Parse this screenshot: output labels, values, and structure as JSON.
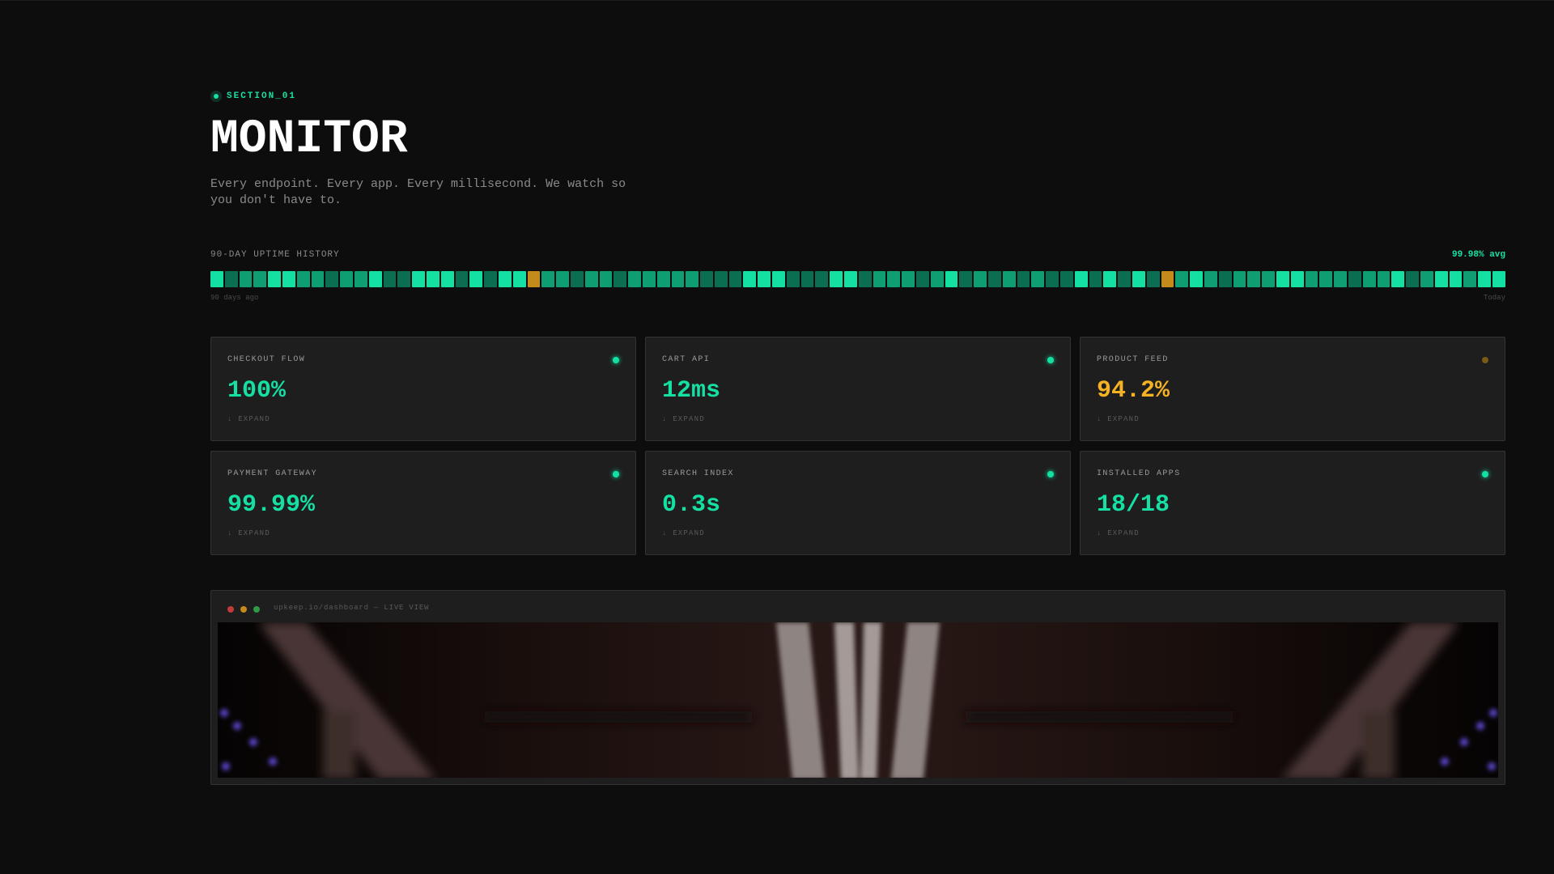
{
  "section": {
    "label": "SECTION_01"
  },
  "header": {
    "title": "MONITOR",
    "subtitle": "Every endpoint. Every app. Every millisecond. We watch so you don't have to."
  },
  "uptime": {
    "title": "90-DAY UPTIME HISTORY",
    "average": "99.98% avg",
    "start_label": "90 days ago",
    "end_label": "Today",
    "days_shown": 90,
    "days": [
      "high",
      "low",
      "mid",
      "mid",
      "high",
      "high",
      "mid",
      "mid",
      "low",
      "mid",
      "mid",
      "high",
      "low",
      "low",
      "high",
      "high",
      "high",
      "low",
      "high",
      "low",
      "high",
      "high",
      "warn",
      "mid",
      "mid",
      "low",
      "mid",
      "mid",
      "low",
      "mid",
      "mid",
      "mid",
      "mid",
      "mid",
      "low",
      "low",
      "low",
      "high",
      "high",
      "high",
      "low",
      "low",
      "low",
      "high",
      "high",
      "low",
      "mid",
      "mid",
      "mid",
      "low",
      "mid",
      "high",
      "low",
      "mid",
      "low",
      "mid",
      "low",
      "mid",
      "low",
      "low",
      "high",
      "low",
      "high",
      "low",
      "high",
      "low",
      "warn",
      "mid",
      "high",
      "mid",
      "low",
      "mid",
      "mid",
      "mid",
      "high",
      "high",
      "mid",
      "mid",
      "mid",
      "low",
      "mid",
      "mid",
      "high",
      "low",
      "mid",
      "high",
      "high",
      "mid",
      "high",
      "high"
    ],
    "colors": {
      "high": "#14e0a4",
      "mid": "#0f9e74",
      "low": "#0b6e52",
      "warn": "#c48a1a"
    }
  },
  "cards": [
    {
      "label": "CHECKOUT FLOW",
      "value": "100%",
      "expand": "↓ EXPAND",
      "status": "ok"
    },
    {
      "label": "CART API",
      "value": "12ms",
      "expand": "↓ EXPAND",
      "status": "ok"
    },
    {
      "label": "PRODUCT FEED",
      "value": "94.2%",
      "expand": "↓ EXPAND",
      "status": "warn"
    },
    {
      "label": "PAYMENT GATEWAY",
      "value": "99.99%",
      "expand": "↓ EXPAND",
      "status": "ok"
    },
    {
      "label": "SEARCH INDEX",
      "value": "0.3s",
      "expand": "↓ EXPAND",
      "status": "ok"
    },
    {
      "label": "INSTALLED APPS",
      "value": "18/18",
      "expand": "↓ EXPAND",
      "status": "ok"
    }
  ],
  "status_colors": {
    "ok": "#14e0a4",
    "warn": "#f5b324",
    "warn_dot": "#7a5a14"
  },
  "browser": {
    "url": "upkeep.io/dashboard — LIVE VIEW"
  }
}
